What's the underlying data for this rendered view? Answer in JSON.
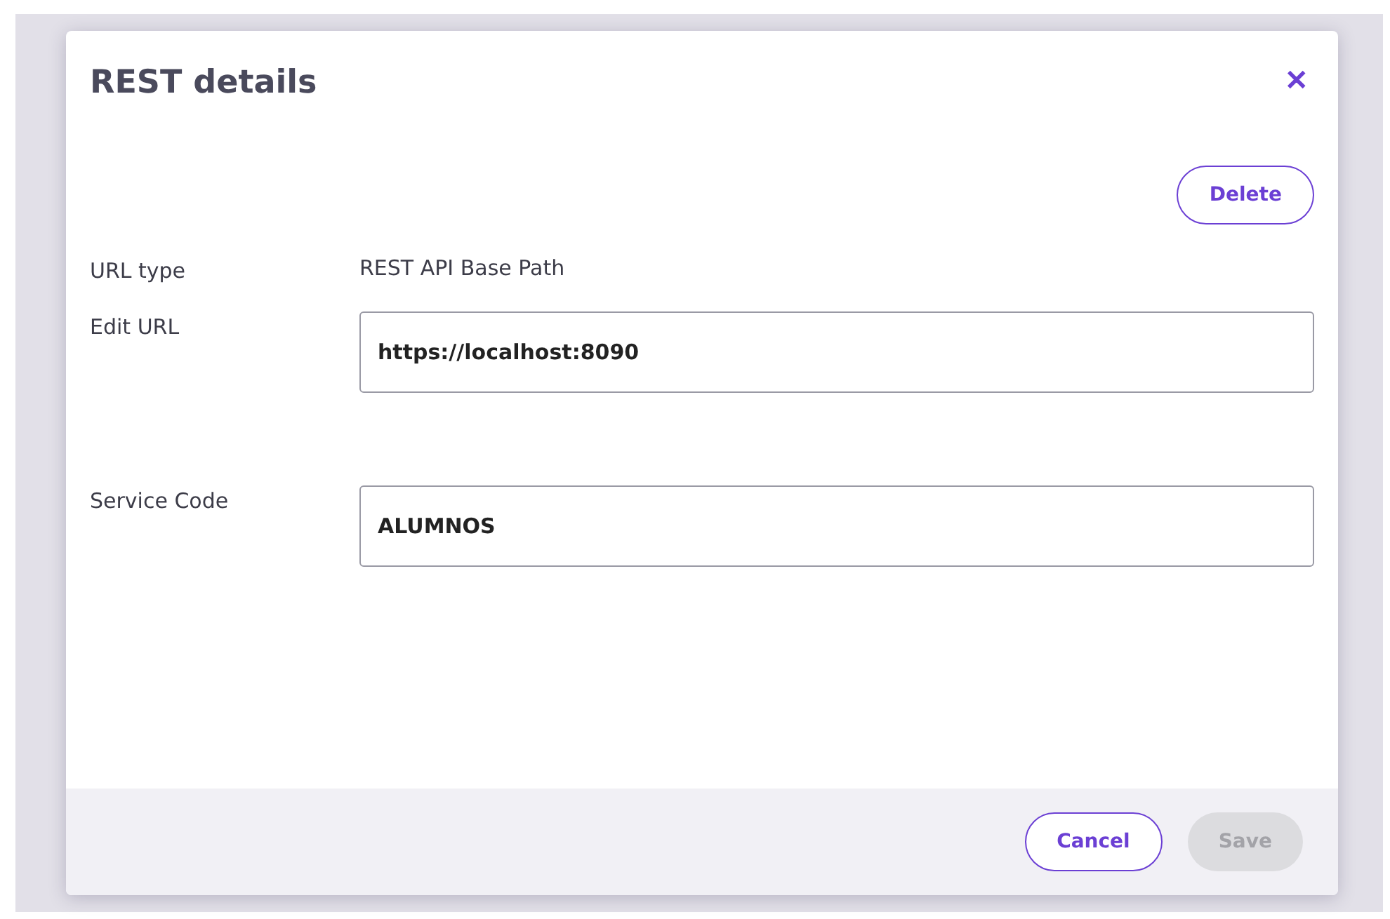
{
  "dialog": {
    "title": "REST details",
    "close": "✕"
  },
  "delete_button": {
    "label": "Delete"
  },
  "fields": [
    {
      "kind": "text",
      "label": "URL type",
      "value": "REST API Base Path"
    },
    {
      "kind": "input",
      "label": "Edit URL",
      "value": "https://localhost:8090"
    },
    {
      "kind": "input",
      "label": "Service Code",
      "value": "ALUMNOS"
    }
  ],
  "footer": {
    "buttons": [
      {
        "label": "Cancel",
        "disabled": false,
        "kind": "outline"
      },
      {
        "label": "Save",
        "disabled": true,
        "kind": "filled"
      }
    ]
  }
}
